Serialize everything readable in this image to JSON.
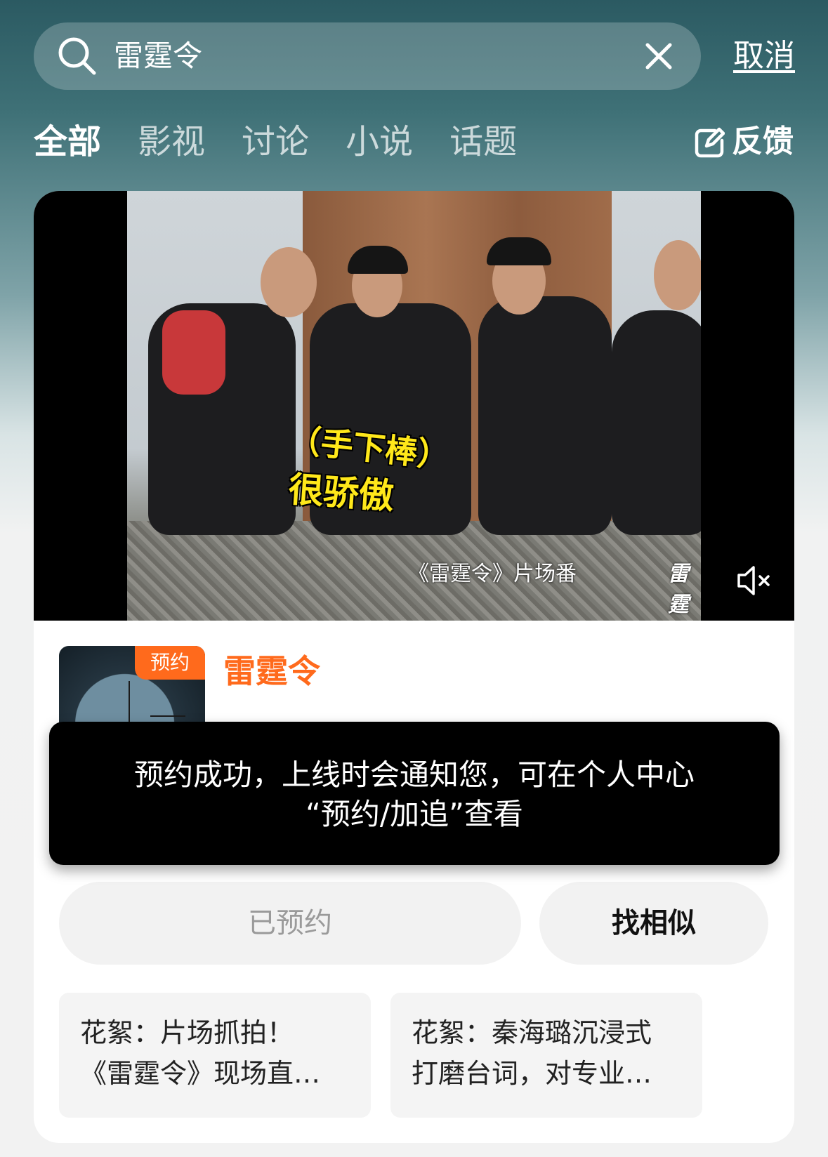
{
  "search": {
    "query": "雷霆令",
    "cancel_label": "取消"
  },
  "tabs": [
    {
      "label": "全部"
    },
    {
      "label": "影视"
    },
    {
      "label": "讨论"
    },
    {
      "label": "小说"
    },
    {
      "label": "话题"
    }
  ],
  "feedback": {
    "label": "反馈"
  },
  "video": {
    "subtitle_line1": "（手下棒）",
    "subtitle_line2": "很骄傲",
    "caption": "《雷霆令》片场番",
    "watermark": "雷霆令"
  },
  "show": {
    "badge": "预约",
    "title": "雷霆令"
  },
  "toast": {
    "line1": "预约成功，上线时会通知您，可在个人中心",
    "line2": "“预约/加追”查看"
  },
  "actions": {
    "reserved_label": "已预约",
    "similar_label": "找相似"
  },
  "clips": [
    {
      "line1": "花絮：片场抓拍！",
      "line2": "《雷霆令》现场直…"
    },
    {
      "line1": "花絮：秦海璐沉浸式",
      "line2": "打磨台词，对专业…"
    }
  ],
  "colors": {
    "accent": "#ff6a1c",
    "toast_bg": "#000000"
  },
  "icons": [
    "search-icon",
    "clear-icon",
    "edit-icon",
    "mute-icon"
  ]
}
